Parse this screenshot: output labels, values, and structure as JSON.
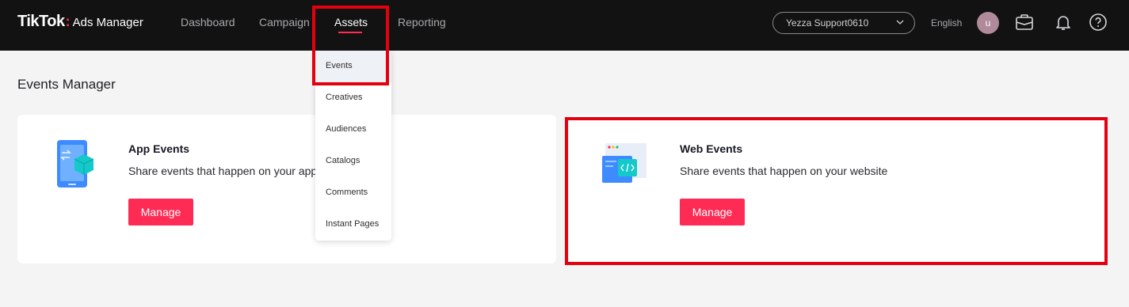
{
  "header": {
    "brand": "TikTok",
    "brand_colon": ":",
    "product": "Ads Manager",
    "nav": {
      "dashboard": "Dashboard",
      "campaign": "Campaign",
      "assets": "Assets",
      "reporting": "Reporting"
    },
    "account": "Yezza Support0610",
    "language": "English",
    "avatar_initial": "u"
  },
  "assets_menu": {
    "items": [
      "Events",
      "Creatives",
      "Audiences",
      "Catalogs",
      "Comments",
      "Instant Pages"
    ],
    "selected": "Events"
  },
  "page": {
    "title": "Events Manager"
  },
  "cards": {
    "app": {
      "title": "App Events",
      "description": "Share events that happen on your app",
      "button": "Manage",
      "icon": "app-phone-icon"
    },
    "web": {
      "title": "Web Events",
      "description": "Share events that happen on your website",
      "button": "Manage",
      "icon": "web-browser-icon"
    }
  },
  "colors": {
    "accent": "#fe2c55",
    "topbar": "#121212",
    "highlight": "#e4000f"
  }
}
